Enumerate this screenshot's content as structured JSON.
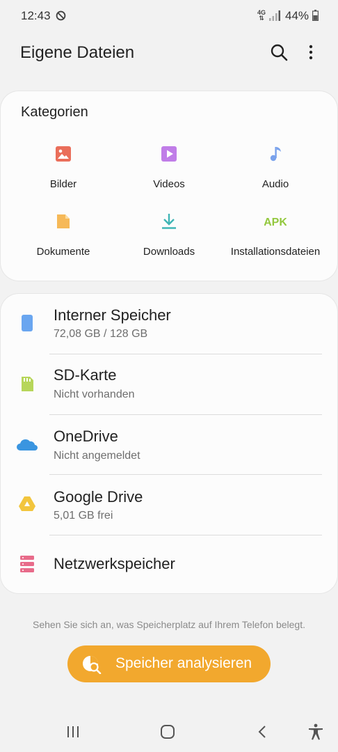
{
  "status_bar": {
    "time": "12:43",
    "network": "4G",
    "battery_percent": "44%",
    "icons": [
      "do-not-disturb-icon",
      "network-4g-icon",
      "signal-icon",
      "battery-icon"
    ]
  },
  "app_bar": {
    "title": "Eigene Dateien",
    "icons": [
      "search-icon",
      "more-options-icon"
    ]
  },
  "categories": {
    "header": "Kategorien",
    "items": [
      {
        "label": "Bilder",
        "icon": "images-icon",
        "color": "#ea6e5a"
      },
      {
        "label": "Videos",
        "icon": "videos-icon",
        "color": "#c07de8"
      },
      {
        "label": "Audio",
        "icon": "audio-icon",
        "color": "#7aa2ec"
      },
      {
        "label": "Dokumente",
        "icon": "documents-icon",
        "color": "#f6b958"
      },
      {
        "label": "Downloads",
        "icon": "downloads-icon",
        "color": "#3fb5b5"
      },
      {
        "label": "Installationsdateien",
        "icon": "apk-icon",
        "icon_text": "APK",
        "color": "#93c83e"
      }
    ]
  },
  "storage": {
    "items": [
      {
        "name": "Interner Speicher",
        "detail": "72,08 GB / 128 GB",
        "icon": "phone-storage-icon",
        "color": "#6aa6f0"
      },
      {
        "name": "SD-Karte",
        "detail": "Nicht vorhanden",
        "icon": "sd-card-icon",
        "color": "#b7d65a"
      },
      {
        "name": "OneDrive",
        "detail": "Nicht angemeldet",
        "icon": "onedrive-icon",
        "color": "#3a95e0"
      },
      {
        "name": "Google Drive",
        "detail": "5,01 GB frei",
        "icon": "google-drive-icon",
        "color": "#f2c53d"
      },
      {
        "name": "Netzwerkspeicher",
        "icon": "network-storage-icon",
        "color": "#e86b8a"
      }
    ]
  },
  "analysis": {
    "hint": "Sehen Sie sich an, was Speicherplatz auf Ihrem Telefon belegt.",
    "button_label": "Speicher analysieren",
    "button_color": "#f2a82e"
  },
  "nav_bar": {
    "icons": [
      "recent-apps-icon",
      "home-icon",
      "back-icon",
      "accessibility-icon"
    ]
  }
}
